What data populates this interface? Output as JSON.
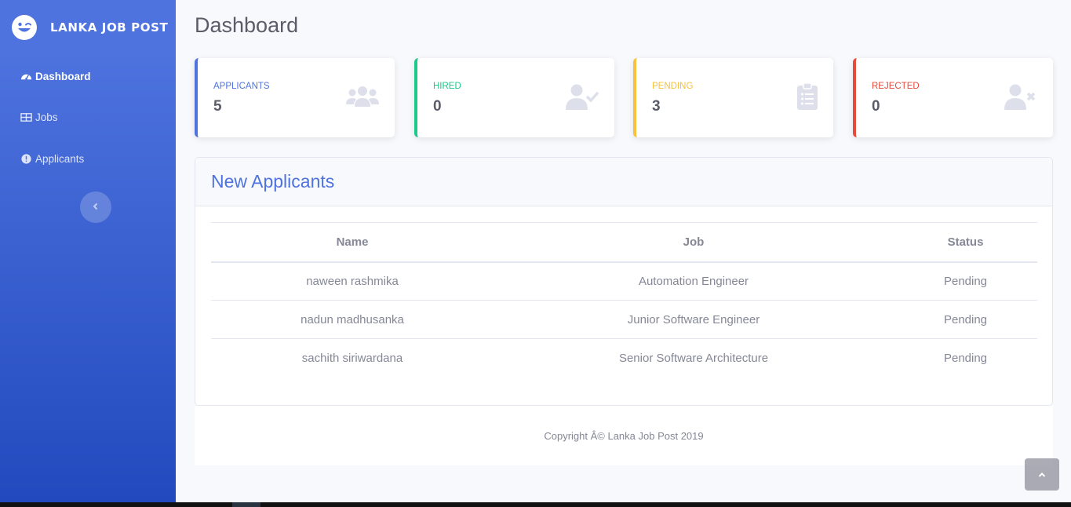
{
  "brand": {
    "title": "LANKA JOB POST",
    "icon": "laugh-wink-icon"
  },
  "sidebar": {
    "items": [
      {
        "label": "Dashboard",
        "icon": "tachometer-icon",
        "active": true
      },
      {
        "label": "Jobs",
        "icon": "table-icon",
        "active": false
      },
      {
        "label": "Applicants",
        "icon": "info-circle-icon",
        "active": false
      }
    ],
    "toggle_icon": "chevron-left-icon"
  },
  "page": {
    "title": "Dashboard"
  },
  "cards": [
    {
      "label": "APPLICANTS",
      "value": "5",
      "color": "#4e73df",
      "icon": "users-icon"
    },
    {
      "label": "HIRED",
      "value": "0",
      "color": "#1cc88a",
      "icon": "user-check-icon"
    },
    {
      "label": "PENDING",
      "value": "3",
      "color": "#f6c23e",
      "icon": "clipboard-list-icon"
    },
    {
      "label": "REJECTED",
      "value": "0",
      "color": "#e74a3b",
      "icon": "user-times-icon"
    }
  ],
  "applicants_panel": {
    "title": "New Applicants",
    "columns": [
      "Name",
      "Job",
      "Status"
    ],
    "rows": [
      [
        "naween rashmika",
        "Automation Engineer",
        "Pending"
      ],
      [
        "nadun madhusanka",
        "Junior Software Engineer",
        "Pending"
      ],
      [
        "sachith siriwardana",
        "Senior Software Architecture",
        "Pending"
      ]
    ]
  },
  "footer": {
    "text": "Copyright Â© Lanka Job Post 2019"
  },
  "scroll_top_icon": "angle-up-icon"
}
